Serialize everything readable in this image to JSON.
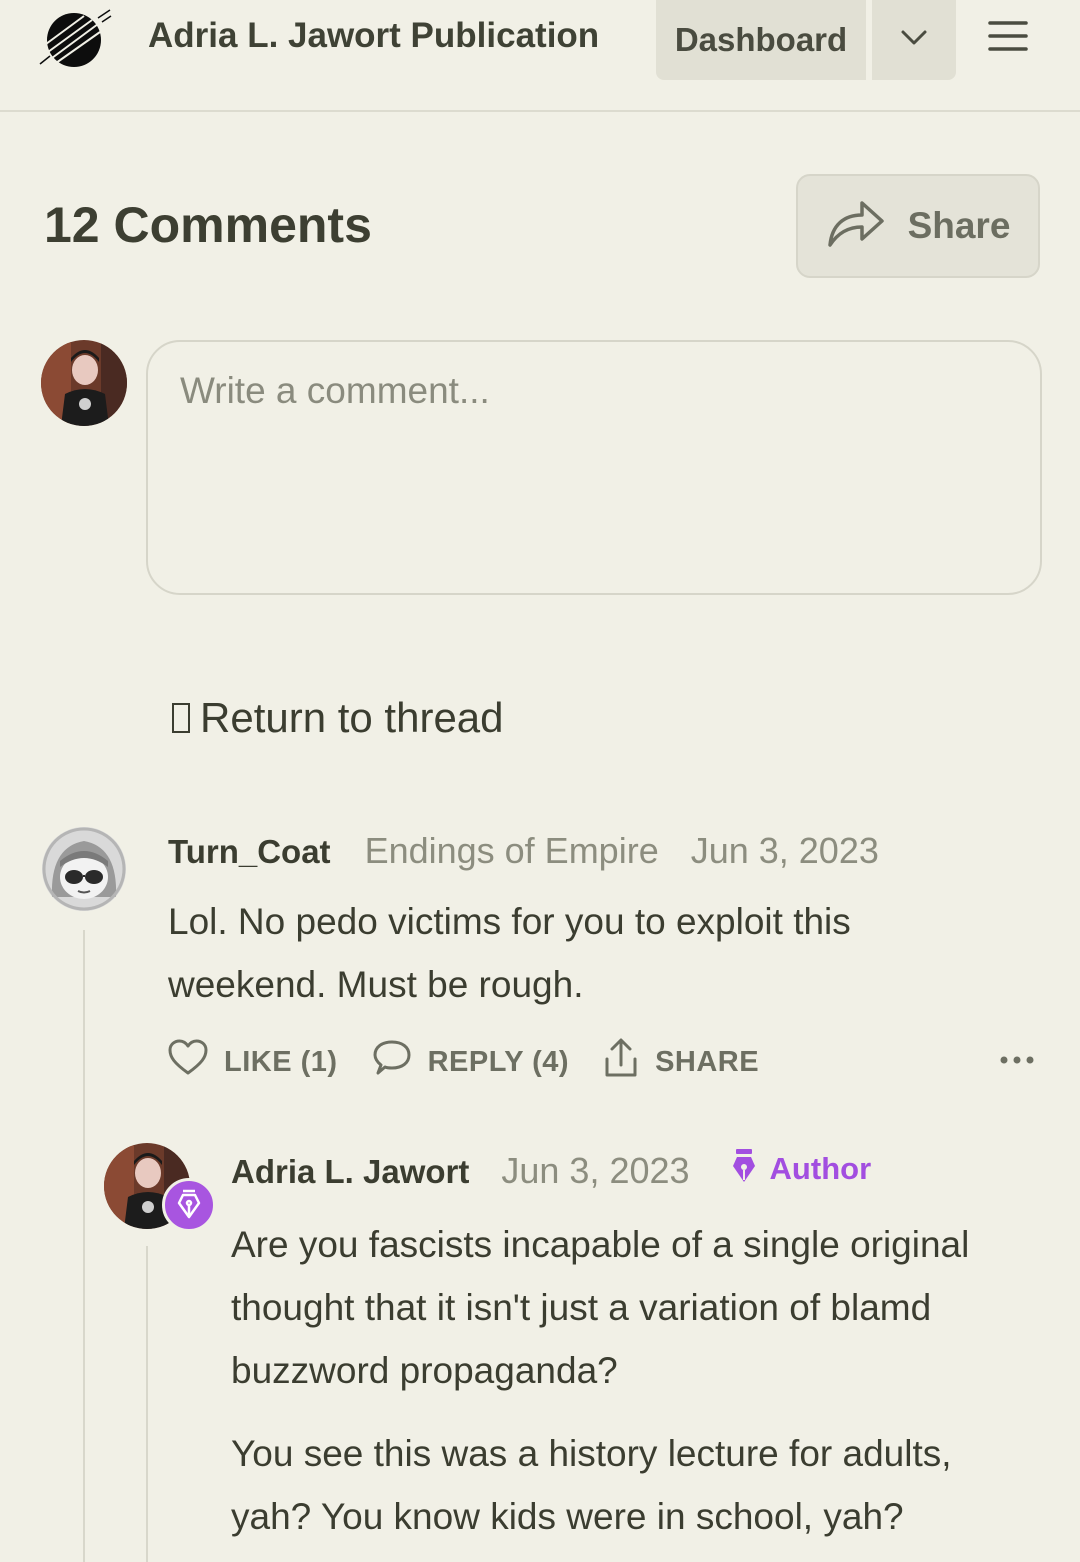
{
  "header": {
    "publication_title": "Adria L. Jawort Publication",
    "dashboard_label": "Dashboard"
  },
  "comments": {
    "title": "12 Comments",
    "share_label": "Share",
    "input_placeholder": "Write a comment...",
    "return_label": "Return to thread"
  },
  "thread": {
    "comment": {
      "author": "Turn_Coat",
      "publication": "Endings of Empire",
      "date": "Jun 3, 2023",
      "body_line1": "Lol. No pedo victims for you to exploit this",
      "body_line2": "weekend. Must be rough.",
      "like_label": "LIKE (1)",
      "reply_label": "REPLY (4)",
      "share_label": "SHARE"
    },
    "reply": {
      "author": "Adria L. Jawort",
      "date": "Jun 3, 2023",
      "badge_label": "Author",
      "badge_color": "#a24ee0",
      "para1_line1": "Are you fascists incapable of a single original",
      "para1_line2": "thought that it isn't just a variation of blamd",
      "para1_line3": "buzzword propaganda?",
      "para2_line1": "You see this was a history lecture for adults,",
      "para2_line2": "yah? You know kids were in school, yah?"
    }
  },
  "icons": {
    "logo": "publication-logo",
    "chevron": "chevron-down-icon",
    "menu": "hamburger-menu-icon",
    "share": "share-arrow-icon",
    "heart": "heart-icon",
    "reply": "speech-bubble-icon",
    "share_upload": "upload-share-icon",
    "more": "more-dots-icon",
    "pen": "fountain-pen-icon"
  }
}
